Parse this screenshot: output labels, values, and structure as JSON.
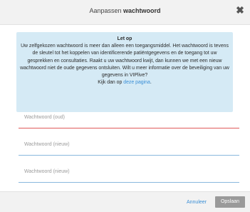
{
  "header": {
    "title_prefix": "Aanpassen",
    "title_bold": "wachtwoord",
    "close_glyph": "✖"
  },
  "notice": {
    "title": "Let op",
    "body": "Uw zelfgekozen wachtwoord is meer dan alleen een toegangsmiddel. Het wachtwoord is tevens de sleutel tot het koppelen van identificerende patiëntgegevens en de toegang tot uw gesprekken en consultaties. Raakt u uw wachtwoord kwijt, dan kunnen we met een nieuw wachtwoord niet de oude gegevens ontsluiten. Wilt u meer informatie over de beveiliging van uw gegevens in VIPlive?",
    "link_prefix": "Kijk dan op",
    "link_text": "deze pagina",
    "link_suffix": "."
  },
  "fields": {
    "old_password": "Wachtwoord (oud)",
    "new_password": "Wachtwoord (nieuw)",
    "new_password_repeat": "Wachtwoord (nieuw)"
  },
  "footer": {
    "cancel_label": "Annuleer",
    "save_label": "Opslaan"
  },
  "colors": {
    "notice_bg": "#d5eaf5",
    "error_line": "#e05a5a",
    "focus_line": "#8ab8de",
    "link": "#3a8fd6",
    "save_button": "#9a9a9a"
  }
}
